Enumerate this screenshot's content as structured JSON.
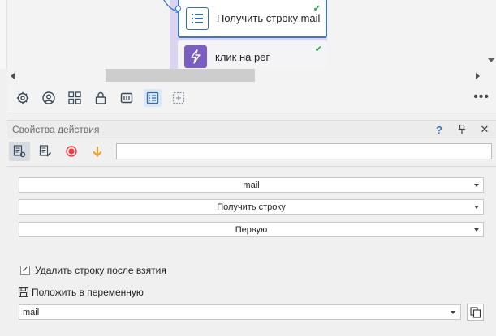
{
  "canvas": {
    "nodes": [
      {
        "label": "Получить строку mail",
        "icon": "list-icon",
        "status": "ok"
      },
      {
        "label": "клик на рег",
        "icon": "lightning-icon",
        "status": "ok"
      }
    ],
    "status_mark": "✔"
  },
  "toolbar": {
    "icons": [
      "gear-icon",
      "user-circle-icon",
      "grid-icon",
      "lock-icon",
      "tablet-icon",
      "list-icon",
      "add-box-icon"
    ],
    "more_label": "•••"
  },
  "panel": {
    "title": "Свойства действия",
    "help_label": "?",
    "pin_label": "⊥",
    "close_label": "✕",
    "search_value": ""
  },
  "fields": {
    "list_name": "mail",
    "operation": "Получить строку",
    "position": "Первую",
    "delete_after_label": "Удалить строку после взятия",
    "delete_after_checked": true,
    "delete_after_mark": "✓",
    "save_to_label": "Положить в переменную",
    "variable": "mail"
  },
  "colors": {
    "accent": "#3a78c2",
    "lane": "#dcd4ee",
    "ok": "#23a34a",
    "record": "#e84040",
    "arrow": "#f0a020",
    "action_icon": "#7a5fc0"
  }
}
